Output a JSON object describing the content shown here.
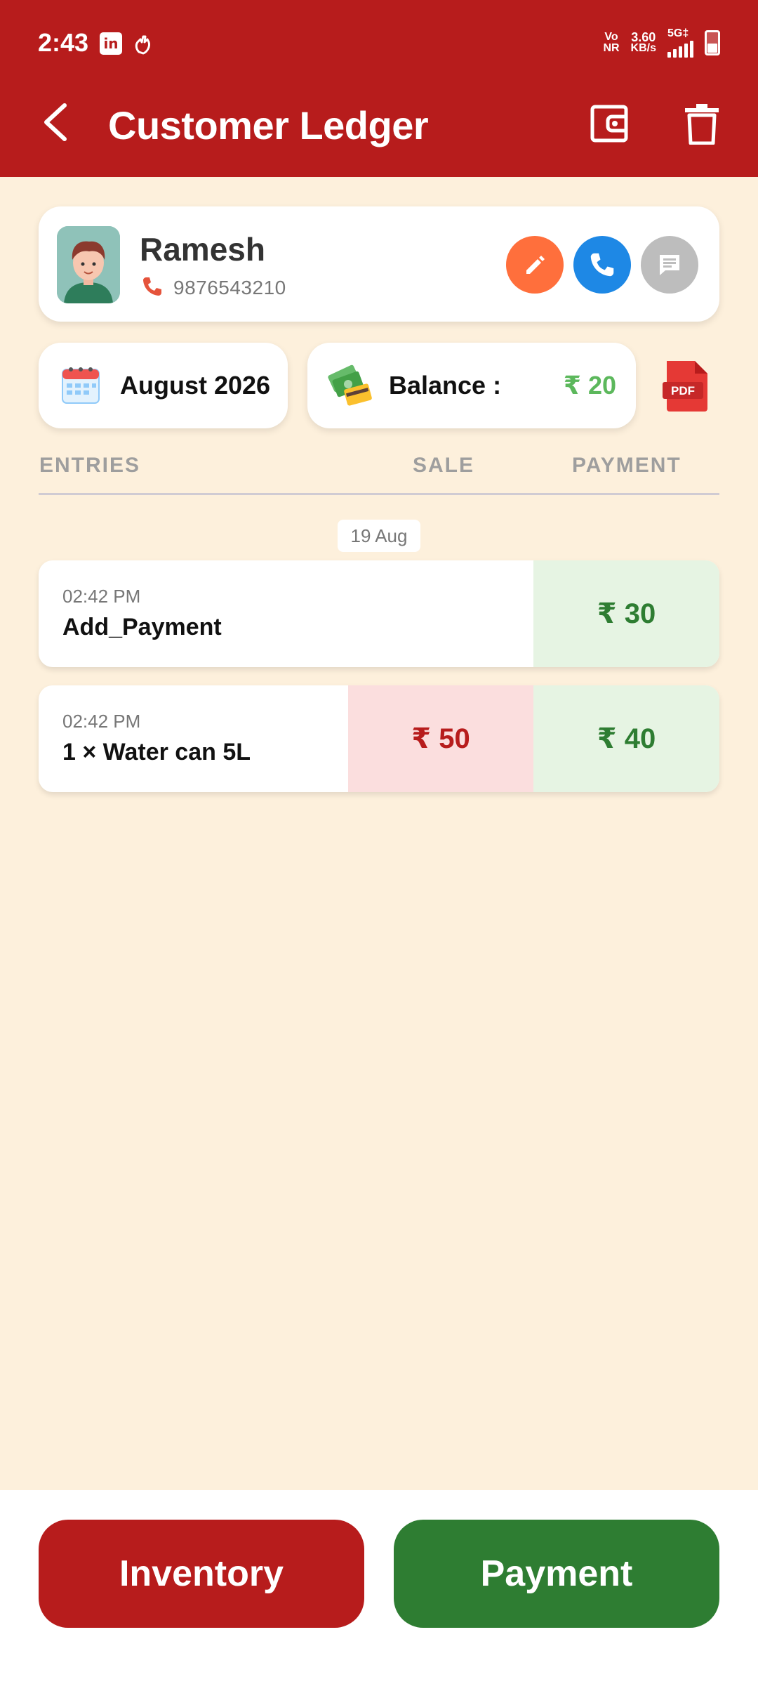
{
  "status_bar": {
    "time": "2:43",
    "linkedin_glyph": "in",
    "network_top": "Vo",
    "network_bottom": "NR",
    "speed_value": "3.60",
    "speed_unit": "KB/s",
    "signal_label": "5G‡",
    "icons": [
      "linkedin-icon",
      "gesture-icon",
      "signal-icon",
      "battery-icon"
    ]
  },
  "app_bar": {
    "title": "Customer Ledger",
    "icons": [
      "back-arrow-icon",
      "wallet-icon",
      "trash-icon"
    ]
  },
  "customer": {
    "name": "Ramesh",
    "phone": "9876543210",
    "actions": [
      "edit-icon",
      "call-icon",
      "message-icon"
    ]
  },
  "summary": {
    "month": "August 2026",
    "balance_label": "Balance :",
    "balance_value": "₹ 20",
    "pdf_label": "PDF"
  },
  "table": {
    "headers": {
      "entries": "ENTRIES",
      "sale": "SALE",
      "payment": "PAYMENT"
    },
    "date_group": "19 Aug",
    "rows": [
      {
        "time": "02:42 PM",
        "description": "Add_Payment",
        "sale": "",
        "payment": "₹ 30"
      },
      {
        "time": "02:42 PM",
        "description": "1 × Water can 5L",
        "sale": "₹ 50",
        "payment": "₹ 40"
      }
    ]
  },
  "bottom_actions": {
    "inventory_label": "Inventory",
    "payment_label": "Payment"
  },
  "colors": {
    "primary_red": "#B71C1C",
    "primary_green": "#2E7D32",
    "background": "#FDF0DC",
    "balance_green": "#5CB85C",
    "edit_orange": "#FF6F3C",
    "call_blue": "#1E88E5",
    "message_grey": "#BDBDBD"
  }
}
